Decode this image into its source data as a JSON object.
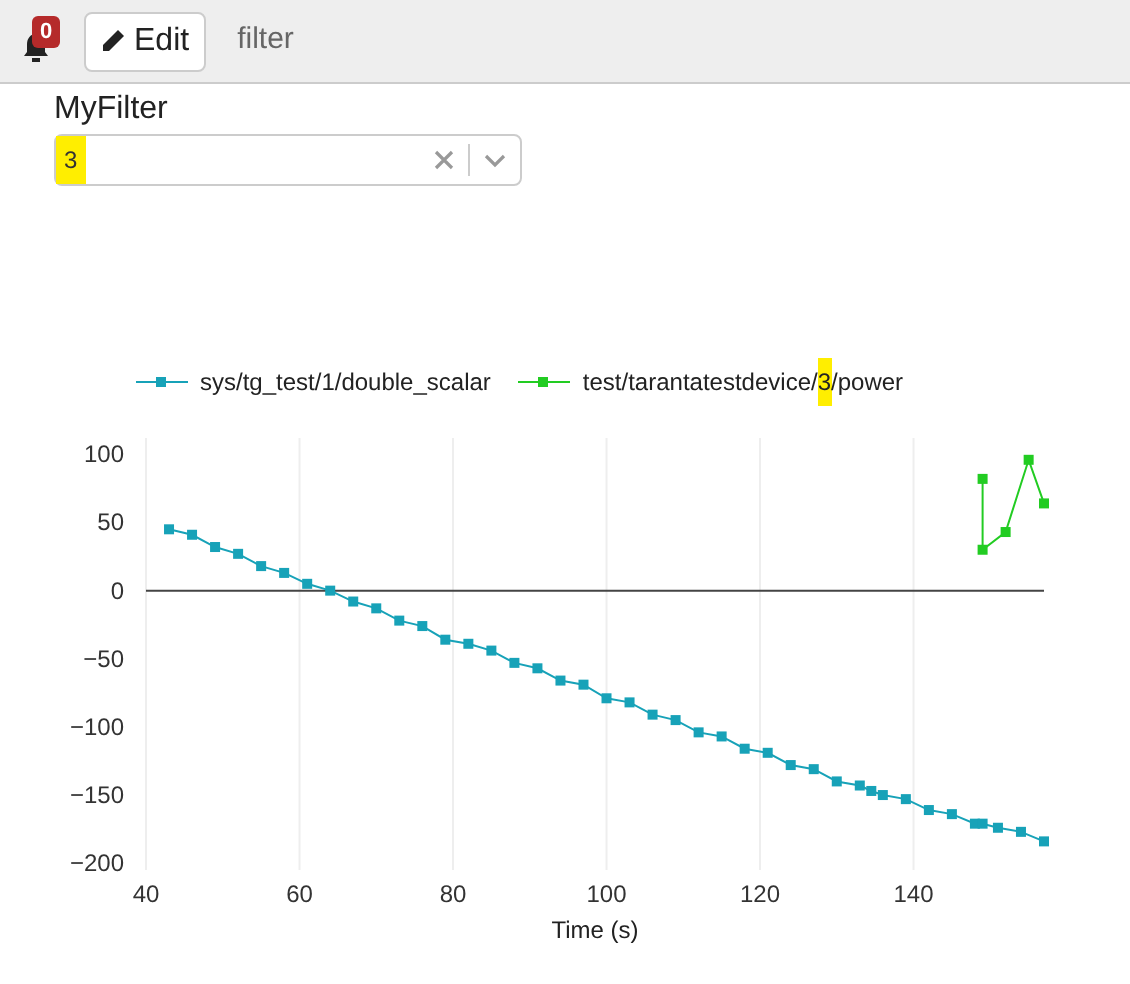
{
  "toolbar": {
    "notifications": {
      "count": "0"
    },
    "edit_button": {
      "label": "Edit"
    },
    "title": "filter"
  },
  "filter": {
    "label": "MyFilter",
    "value": "3",
    "highlighted": true
  },
  "chart_data": {
    "type": "line",
    "grid": true,
    "xlabel": "Time (s)",
    "xlim": [
      40,
      157
    ],
    "ylim": [
      -205,
      112
    ],
    "xticks": [
      40,
      60,
      80,
      100,
      120,
      140
    ],
    "yticks": [
      {
        "value": 100,
        "label": "100"
      },
      {
        "value": 50,
        "label": "50"
      },
      {
        "value": 0,
        "label": "0"
      },
      {
        "value": -50,
        "label": "−50"
      },
      {
        "value": -100,
        "label": "−100"
      },
      {
        "value": -150,
        "label": "−150"
      },
      {
        "value": -200,
        "label": "−200"
      }
    ],
    "series": [
      {
        "name": "sys/tg_test/1/double_scalar",
        "color": "#17a2b8",
        "marker": "square",
        "x": [
          43,
          46,
          49,
          52,
          55,
          58,
          61,
          64,
          67,
          70,
          73,
          76,
          79,
          82,
          85,
          88,
          91,
          94,
          97,
          100,
          103,
          106,
          109,
          112,
          115,
          118,
          121,
          124,
          127,
          130,
          133,
          134.5,
          136,
          139,
          142,
          145,
          148,
          149,
          151,
          154,
          157
        ],
        "values": [
          45,
          41,
          32,
          27,
          18,
          13,
          5,
          0,
          -8,
          -13,
          -22,
          -26,
          -36,
          -39,
          -44,
          -53,
          -57,
          -66,
          -69,
          -79,
          -82,
          -91,
          -95,
          -104,
          -107,
          -116,
          -119,
          -128,
          -131,
          -140,
          -143,
          -147,
          -150,
          -153,
          -161,
          -164,
          -171,
          -171,
          -174,
          -177,
          -184
        ]
      },
      {
        "name": "test/tarantatestdevice/3/power",
        "color": "#22cc22",
        "marker": "square",
        "x": [
          149,
          149,
          152,
          155,
          157
        ],
        "values": [
          82,
          30,
          43,
          96,
          64
        ]
      }
    ]
  }
}
